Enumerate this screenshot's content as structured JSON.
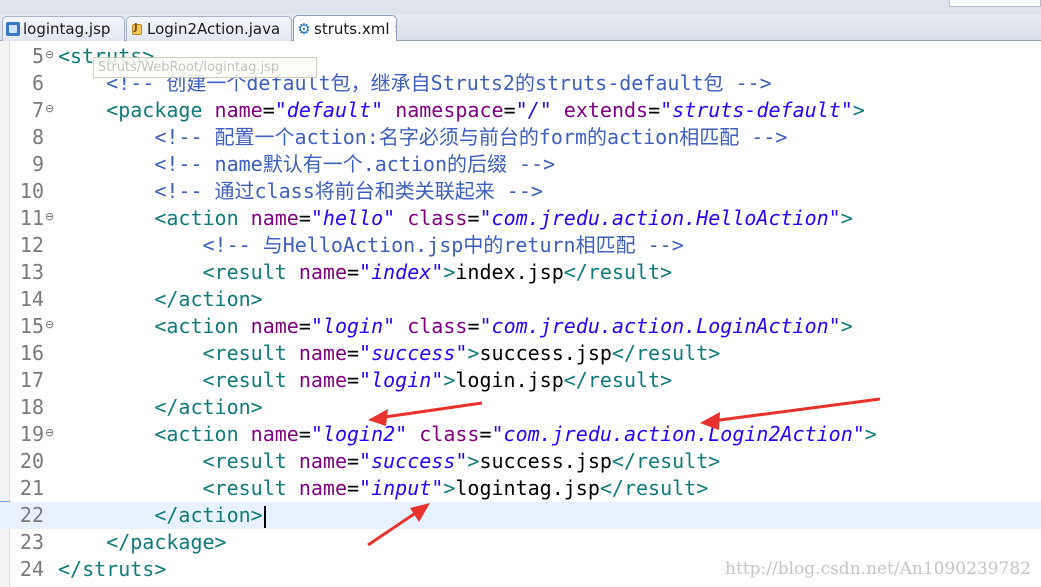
{
  "tabs": [
    {
      "label": "logintag.jsp",
      "icon": "jsp-file-icon",
      "active": false
    },
    {
      "label": "Login2Action.java",
      "icon": "java-file-icon",
      "active": false
    },
    {
      "label": "struts.xml",
      "icon": "xml-gear-icon",
      "active": true,
      "close": "×"
    }
  ],
  "tooltip": "Struts/WebRoot/logintag.jsp",
  "watermark": "http://blog.csdn.net/An1090239782",
  "colors": {
    "arrow": "#e8322d",
    "tag": "#117a7a",
    "attribute": "#7f007f",
    "value": "#2a00ff",
    "comment": "#3f5fbf"
  },
  "editor": {
    "current_line": 22,
    "lines": [
      {
        "n": "5",
        "fold": "⊖",
        "tokens": [
          {
            "t": "tag",
            "v": "<struts>"
          }
        ]
      },
      {
        "n": "6",
        "fold": "",
        "tokens": [
          {
            "t": "sp",
            "v": "    "
          },
          {
            "t": "cmt",
            "v": "<!-- 创建一个default包，继承自Struts2的struts-default包 -->"
          }
        ]
      },
      {
        "n": "7",
        "fold": "⊖",
        "tokens": [
          {
            "t": "sp",
            "v": "    "
          },
          {
            "t": "tag",
            "v": "<package "
          },
          {
            "t": "attr",
            "v": "name"
          },
          {
            "t": "txt",
            "v": "="
          },
          {
            "t": "val",
            "v": "\"default\""
          },
          {
            "t": "sp",
            "v": " "
          },
          {
            "t": "attr",
            "v": "namespace"
          },
          {
            "t": "txt",
            "v": "="
          },
          {
            "t": "val",
            "v": "\"/\""
          },
          {
            "t": "sp",
            "v": " "
          },
          {
            "t": "attr",
            "v": "extends"
          },
          {
            "t": "txt",
            "v": "="
          },
          {
            "t": "val",
            "v": "\"struts-default\""
          },
          {
            "t": "tag",
            "v": ">"
          }
        ]
      },
      {
        "n": "8",
        "fold": "",
        "tokens": [
          {
            "t": "sp",
            "v": "        "
          },
          {
            "t": "cmt",
            "v": "<!-- 配置一个action:名字必须与前台的form的action相匹配 -->"
          }
        ]
      },
      {
        "n": "9",
        "fold": "",
        "tokens": [
          {
            "t": "sp",
            "v": "        "
          },
          {
            "t": "cmt",
            "v": "<!-- name默认有一个.action的后缀 -->"
          }
        ]
      },
      {
        "n": "10",
        "fold": "",
        "tokens": [
          {
            "t": "sp",
            "v": "        "
          },
          {
            "t": "cmt",
            "v": "<!-- 通过class将前台和类关联起来 -->"
          }
        ]
      },
      {
        "n": "11",
        "fold": "⊖",
        "tokens": [
          {
            "t": "sp",
            "v": "        "
          },
          {
            "t": "tag",
            "v": "<action "
          },
          {
            "t": "attr",
            "v": "name"
          },
          {
            "t": "txt",
            "v": "="
          },
          {
            "t": "val",
            "v": "\"hello\""
          },
          {
            "t": "sp",
            "v": " "
          },
          {
            "t": "attr",
            "v": "class"
          },
          {
            "t": "txt",
            "v": "="
          },
          {
            "t": "val",
            "v": "\"com.jredu.action.HelloAction\""
          },
          {
            "t": "tag",
            "v": ">"
          }
        ]
      },
      {
        "n": "12",
        "fold": "",
        "tokens": [
          {
            "t": "sp",
            "v": "            "
          },
          {
            "t": "cmt",
            "v": "<!-- 与HelloAction.jsp中的return相匹配 -->"
          }
        ]
      },
      {
        "n": "13",
        "fold": "",
        "tokens": [
          {
            "t": "sp",
            "v": "            "
          },
          {
            "t": "tag",
            "v": "<result "
          },
          {
            "t": "attr",
            "v": "name"
          },
          {
            "t": "txt",
            "v": "="
          },
          {
            "t": "val",
            "v": "\"index\""
          },
          {
            "t": "tag",
            "v": ">"
          },
          {
            "t": "txt",
            "v": "index.jsp"
          },
          {
            "t": "tag",
            "v": "</result>"
          }
        ]
      },
      {
        "n": "14",
        "fold": "",
        "tokens": [
          {
            "t": "sp",
            "v": "        "
          },
          {
            "t": "tag",
            "v": "</action>"
          }
        ]
      },
      {
        "n": "15",
        "fold": "⊖",
        "tokens": [
          {
            "t": "sp",
            "v": "        "
          },
          {
            "t": "tag",
            "v": "<action "
          },
          {
            "t": "attr",
            "v": "name"
          },
          {
            "t": "txt",
            "v": "="
          },
          {
            "t": "val",
            "v": "\"login\""
          },
          {
            "t": "sp",
            "v": " "
          },
          {
            "t": "attr",
            "v": "class"
          },
          {
            "t": "txt",
            "v": "="
          },
          {
            "t": "val",
            "v": "\"com.jredu.action.LoginAction\""
          },
          {
            "t": "tag",
            "v": ">"
          }
        ]
      },
      {
        "n": "16",
        "fold": "",
        "tokens": [
          {
            "t": "sp",
            "v": "            "
          },
          {
            "t": "tag",
            "v": "<result "
          },
          {
            "t": "attr",
            "v": "name"
          },
          {
            "t": "txt",
            "v": "="
          },
          {
            "t": "val",
            "v": "\"success\""
          },
          {
            "t": "tag",
            "v": ">"
          },
          {
            "t": "txt",
            "v": "success.jsp"
          },
          {
            "t": "tag",
            "v": "</result>"
          }
        ]
      },
      {
        "n": "17",
        "fold": "",
        "tokens": [
          {
            "t": "sp",
            "v": "            "
          },
          {
            "t": "tag",
            "v": "<result "
          },
          {
            "t": "attr",
            "v": "name"
          },
          {
            "t": "txt",
            "v": "="
          },
          {
            "t": "val",
            "v": "\"login\""
          },
          {
            "t": "tag",
            "v": ">"
          },
          {
            "t": "txt",
            "v": "login.jsp"
          },
          {
            "t": "tag",
            "v": "</result>"
          }
        ]
      },
      {
        "n": "18",
        "fold": "",
        "tokens": [
          {
            "t": "sp",
            "v": "        "
          },
          {
            "t": "tag",
            "v": "</action>"
          }
        ]
      },
      {
        "n": "19",
        "fold": "⊖",
        "tokens": [
          {
            "t": "sp",
            "v": "        "
          },
          {
            "t": "tag",
            "v": "<action "
          },
          {
            "t": "attr",
            "v": "name"
          },
          {
            "t": "txt",
            "v": "="
          },
          {
            "t": "val",
            "v": "\"login2\""
          },
          {
            "t": "sp",
            "v": " "
          },
          {
            "t": "attr",
            "v": "class"
          },
          {
            "t": "txt",
            "v": "="
          },
          {
            "t": "val",
            "v": "\"com.jredu.action.Login2Action\""
          },
          {
            "t": "tag",
            "v": ">"
          }
        ]
      },
      {
        "n": "20",
        "fold": "",
        "tokens": [
          {
            "t": "sp",
            "v": "            "
          },
          {
            "t": "tag",
            "v": "<result "
          },
          {
            "t": "attr",
            "v": "name"
          },
          {
            "t": "txt",
            "v": "="
          },
          {
            "t": "val",
            "v": "\"success\""
          },
          {
            "t": "tag",
            "v": ">"
          },
          {
            "t": "txt",
            "v": "success.jsp"
          },
          {
            "t": "tag",
            "v": "</result>"
          }
        ]
      },
      {
        "n": "21",
        "fold": "",
        "tokens": [
          {
            "t": "sp",
            "v": "            "
          },
          {
            "t": "tag",
            "v": "<result "
          },
          {
            "t": "attr",
            "v": "name"
          },
          {
            "t": "txt",
            "v": "="
          },
          {
            "t": "val",
            "v": "\"input\""
          },
          {
            "t": "tag",
            "v": ">"
          },
          {
            "t": "txt",
            "v": "logintag.jsp"
          },
          {
            "t": "tag",
            "v": "</result>"
          }
        ]
      },
      {
        "n": "22",
        "fold": "",
        "tokens": [
          {
            "t": "sp",
            "v": "        "
          },
          {
            "t": "tag",
            "v": "</action>"
          },
          {
            "t": "caret",
            "v": ""
          }
        ]
      },
      {
        "n": "23",
        "fold": "",
        "tokens": [
          {
            "t": "sp",
            "v": "    "
          },
          {
            "t": "tag",
            "v": "</package>"
          }
        ]
      },
      {
        "n": "24",
        "fold": "",
        "tokens": [
          {
            "t": "tag",
            "v": "</struts>"
          }
        ]
      }
    ]
  }
}
